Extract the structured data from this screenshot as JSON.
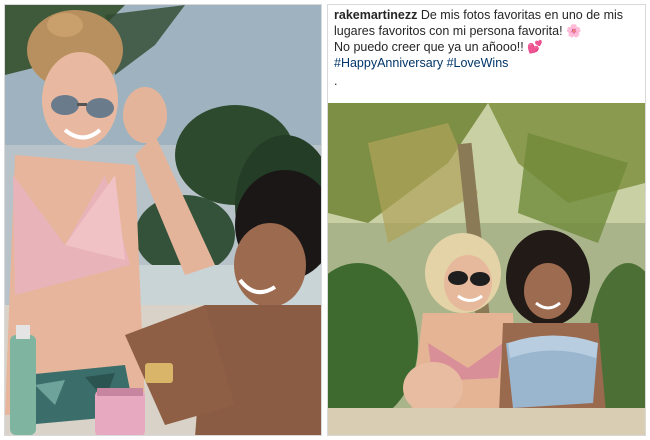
{
  "left_photo": {
    "alt_subject": "beach-photo"
  },
  "post": {
    "username": "rakemartinezz",
    "caption_line1": "De mis fotos favoritas en uno de mis",
    "caption_line2": "lugares favoritos con mi persona favorita! 🌸",
    "caption_line3": "No puedo creer que ya un añooo!! 💕",
    "hashtags": [
      "#HappyAnniversary",
      "#LoveWins"
    ],
    "trailing": "."
  },
  "colors": {
    "hashtag": "#003569",
    "text": "#262626"
  }
}
